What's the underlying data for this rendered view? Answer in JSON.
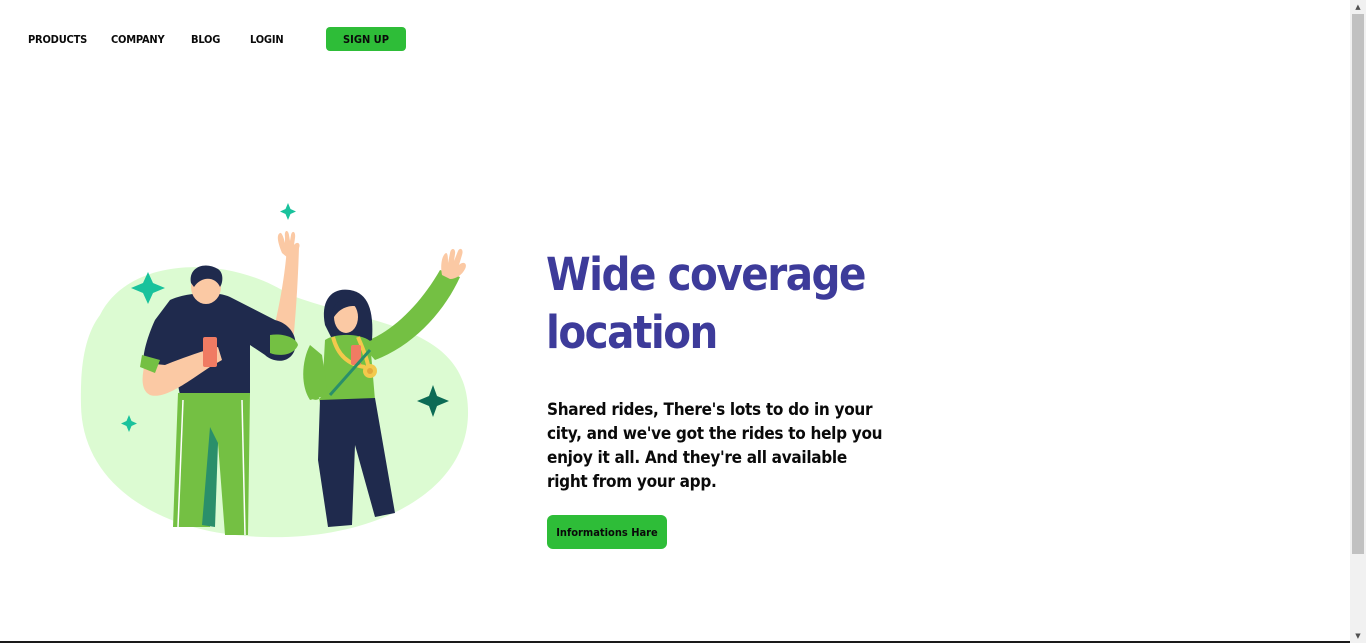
{
  "nav": {
    "products": "PRODUCTS",
    "company": "COMPANY",
    "blog": "BLOG",
    "login": "LOGIN",
    "signup": "SIGN UP"
  },
  "hero": {
    "title": "Wide coverage location",
    "description": "Shared rides, There's lots to do in your city, and we've got the rides to help you enjoy it all. And they're all available right from your app.",
    "button": "Informations Hare"
  },
  "colors": {
    "accent_green": "#2ebd38",
    "title_purple": "#3d3b9a",
    "blob_green": "#dcfbd2",
    "shirt_green": "#74c043",
    "navy": "#1f2a4d",
    "sparkle_teal": "#19c29c",
    "sparkle_dark": "#0c6b55",
    "phone_coral": "#f07b63"
  },
  "icons": {
    "scroll_up": "▲",
    "scroll_down": "▼"
  }
}
